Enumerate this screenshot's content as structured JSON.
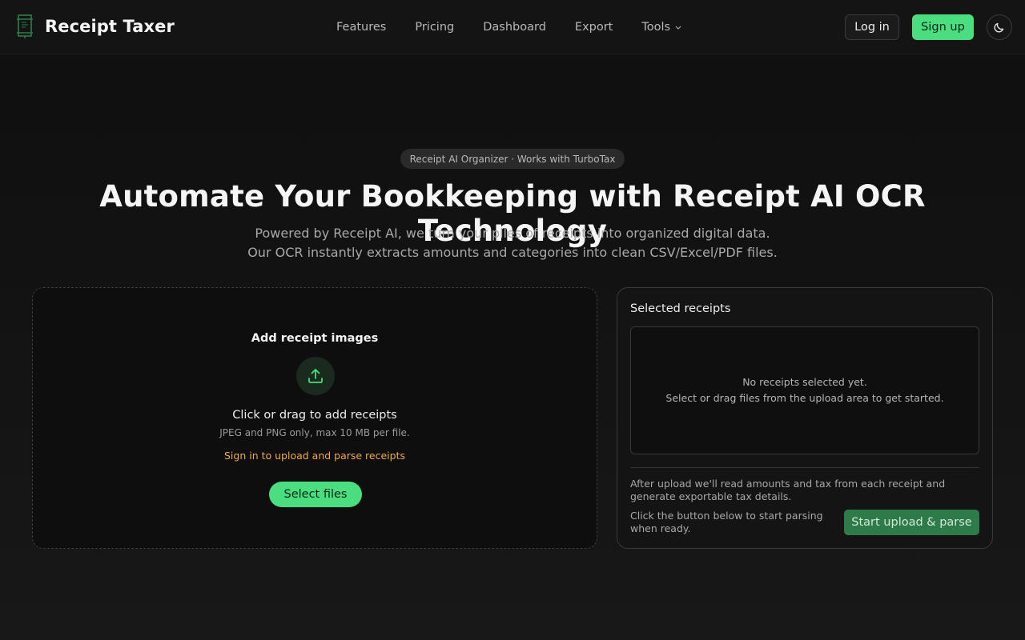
{
  "nav": {
    "brand": "Receipt Taxer",
    "links": [
      "Features",
      "Pricing",
      "Dashboard",
      "Export",
      "Tools"
    ],
    "login_label": "Log in",
    "signup_label": "Sign up",
    "theme_icon": "moon-icon"
  },
  "hero": {
    "badge": "Receipt AI Organizer · Works with TurboTax",
    "title": "Automate Your Bookkeeping with Receipt AI OCR Technology",
    "subtitle_line1": "Powered by Receipt AI, we turn your piles of receipts into organized digital data.",
    "subtitle_line2": "Our OCR instantly extracts amounts and categories into clean CSV/Excel/PDF files."
  },
  "upload": {
    "title": "Add receipt images",
    "icon": "upload-icon",
    "main_text": "Click or drag to add receipts",
    "hint": "JPEG and PNG only, max 10 MB per file.",
    "signin_prompt": "Sign in to upload and parse receipts",
    "select_label": "Select files"
  },
  "selected": {
    "title": "Selected receipts",
    "empty_line1": "No receipts selected yet.",
    "empty_line2": "Select or drag files from the upload area to get started.",
    "note": "After upload we'll read amounts and tax from each receipt and generate exportable tax details.",
    "note2": "Click the button below to start parsing when ready.",
    "start_label": "Start upload & parse"
  },
  "colors": {
    "accent": "#4ade80",
    "warning_text": "#f0a94a",
    "start_button": "#2f7a49"
  }
}
